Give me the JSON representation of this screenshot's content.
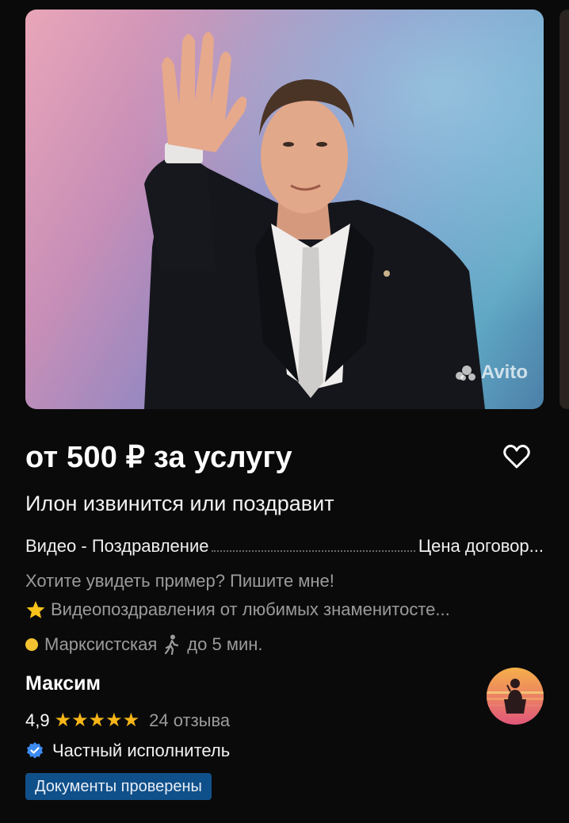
{
  "photo": {
    "alt": "Илон",
    "watermark": "Avito"
  },
  "listing": {
    "price": "от 500 ₽ за услугу",
    "title": "Илон извинится или поздравит",
    "param_name": "Видео - Поздравление",
    "param_value": "Цена договор...",
    "description_line1": "Хотите увидеть пример? Пишите мне!",
    "description_line2": "Видеопоздравления от любимых знаменитосте...",
    "description_line2_icon": "star-emoji",
    "metro_station": "Марксистская",
    "metro_color": "#f2c230",
    "walk_time": "до 5 мин.",
    "walk_icon": "walking-person-icon"
  },
  "seller": {
    "name": "Максим",
    "rating": "4,9",
    "stars": "★★★★★",
    "reviews": "24 отзыва",
    "type": "Частный исполнитель",
    "verified_badge": "Документы проверены"
  },
  "colors": {
    "background": "#0a0a0a",
    "star": "#f7b518",
    "badge": "#10508a",
    "check": "#3d8bf2"
  }
}
